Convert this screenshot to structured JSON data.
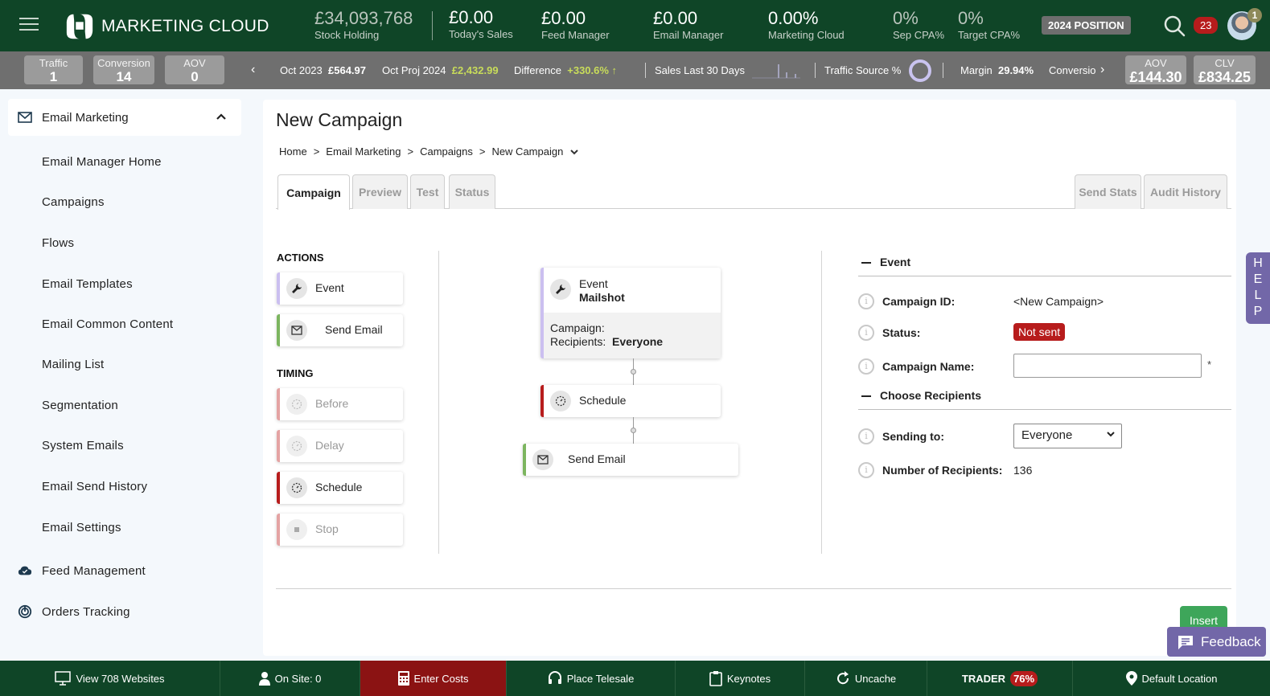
{
  "header": {
    "app_title": "MARKETING CLOUD",
    "stats": [
      {
        "value": "£34,093,768",
        "label": "Stock Holding"
      },
      {
        "value": "£0.00",
        "label": "Today's Sales"
      },
      {
        "value": "£0.00",
        "label": "Feed Manager"
      },
      {
        "value": "£0.00",
        "label": "Email Manager"
      },
      {
        "value": "0.00%",
        "label": "Marketing Cloud"
      },
      {
        "value": "0%",
        "label": "Sep CPA%"
      },
      {
        "value": "0%",
        "label": "Target CPA%"
      }
    ],
    "position_button": "2024 POSITION",
    "notification_count": "23",
    "avatar_badge": "1"
  },
  "subbar": {
    "kpis_left": [
      {
        "label": "Traffic",
        "value": "1"
      },
      {
        "label": "Conversion",
        "value": "14"
      },
      {
        "label": "AOV",
        "value": "0"
      }
    ],
    "oct_2023_label": "Oct 2023",
    "oct_2023_value": "£564.97",
    "oct_proj_label": "Oct Proj 2024",
    "oct_proj_value": "£2,432.99",
    "difference_label": "Difference",
    "difference_value": "+330.6% ↑",
    "sales_30_label": "Sales Last 30 Days",
    "traffic_source_label": "Traffic Source %",
    "margin_label": "Margin",
    "margin_value": "29.94%",
    "conversion_label": "Conversio",
    "kpis_right": [
      {
        "label": "AOV",
        "value": "£144.30"
      },
      {
        "label": "CLV",
        "value": "£834.25"
      }
    ]
  },
  "sidebar": {
    "section": "Email Marketing",
    "items": [
      {
        "label": "Email Manager Home"
      },
      {
        "label": "Campaigns"
      },
      {
        "label": "Flows"
      },
      {
        "label": "Email Templates"
      },
      {
        "label": "Email Common Content"
      },
      {
        "label": "Mailing List"
      },
      {
        "label": "Segmentation"
      },
      {
        "label": "System Emails"
      },
      {
        "label": "Email Send History"
      },
      {
        "label": "Email Settings"
      }
    ],
    "other_sections": [
      {
        "label": "Feed Management",
        "icon": "cloud-check-icon"
      },
      {
        "label": "Orders Tracking",
        "icon": "radar-icon"
      }
    ]
  },
  "main": {
    "title": "New Campaign",
    "breadcrumb": [
      "Home",
      "Email Marketing",
      "Campaigns",
      "New Campaign"
    ],
    "breadcrumb_sep": ">",
    "tabs": [
      {
        "label": "Campaign",
        "active": true
      },
      {
        "label": "Preview"
      },
      {
        "label": "Test"
      },
      {
        "label": "Status"
      }
    ],
    "right_tabs": [
      {
        "label": "Send Stats"
      },
      {
        "label": "Audit History"
      }
    ],
    "palette": {
      "actions_label": "ACTIONS",
      "actions": [
        {
          "label": "Event",
          "icon": "wrench-icon",
          "color": "#cbbff0"
        },
        {
          "label": "Send Email",
          "icon": "envelope-icon",
          "color": "#7cb55f"
        }
      ],
      "timing_label": "TIMING",
      "timing": [
        {
          "label": "Before",
          "icon": "timer-icon",
          "disabled": true,
          "color": "#e4a3a3"
        },
        {
          "label": "Delay",
          "icon": "timer-icon",
          "disabled": true,
          "color": "#e4a3a3"
        },
        {
          "label": "Schedule",
          "icon": "timer-icon",
          "disabled": false,
          "color": "#b71c1c"
        },
        {
          "label": "Stop",
          "icon": "stop-icon",
          "disabled": true,
          "color": "#e4a3a3"
        }
      ]
    },
    "flow": {
      "event_node": {
        "type": "Event",
        "name": "Mailshot",
        "campaign_label": "Campaign:",
        "campaign_value": "",
        "recipients_label": "Recipients:",
        "recipients_value": "Everyone"
      },
      "schedule_node": {
        "label": "Schedule"
      },
      "send_node": {
        "label": "Send Email"
      }
    },
    "form": {
      "event_section": "Event",
      "campaign_id_label": "Campaign ID:",
      "campaign_id_value": "<New Campaign>",
      "status_label": "Status:",
      "status_value": "Not sent",
      "campaign_name_label": "Campaign Name:",
      "campaign_name_value": "",
      "required_mark": "*",
      "recipients_section": "Choose Recipients",
      "sending_to_label": "Sending to:",
      "sending_to_value": "Everyone",
      "num_recipients_label": "Number of Recipients:",
      "num_recipients_value": "136"
    },
    "insert_button": "Insert"
  },
  "floating": {
    "help_label": "HELP",
    "feedback_label": "Feedback"
  },
  "footer": {
    "items": [
      {
        "label": "View 708 Websites",
        "icon": "monitor-icon"
      },
      {
        "label": "On Site:  0",
        "icon": "user-icon"
      },
      {
        "label": "Enter Costs",
        "icon": "calculator-icon"
      },
      {
        "label": "Place Telesale",
        "icon": "headset-icon"
      },
      {
        "label": "Keynotes",
        "icon": "clipboard-icon"
      },
      {
        "label": "Uncache",
        "icon": "refresh-icon"
      },
      {
        "label": "TRADER",
        "badge": "76%"
      },
      {
        "label": "Default Location",
        "icon": "map-pin-icon"
      }
    ]
  },
  "colors": {
    "brand_green": "#0f4527",
    "accent_purple": "#7267a8",
    "status_red": "#b71c1c",
    "insert_green": "#3ea65a"
  }
}
